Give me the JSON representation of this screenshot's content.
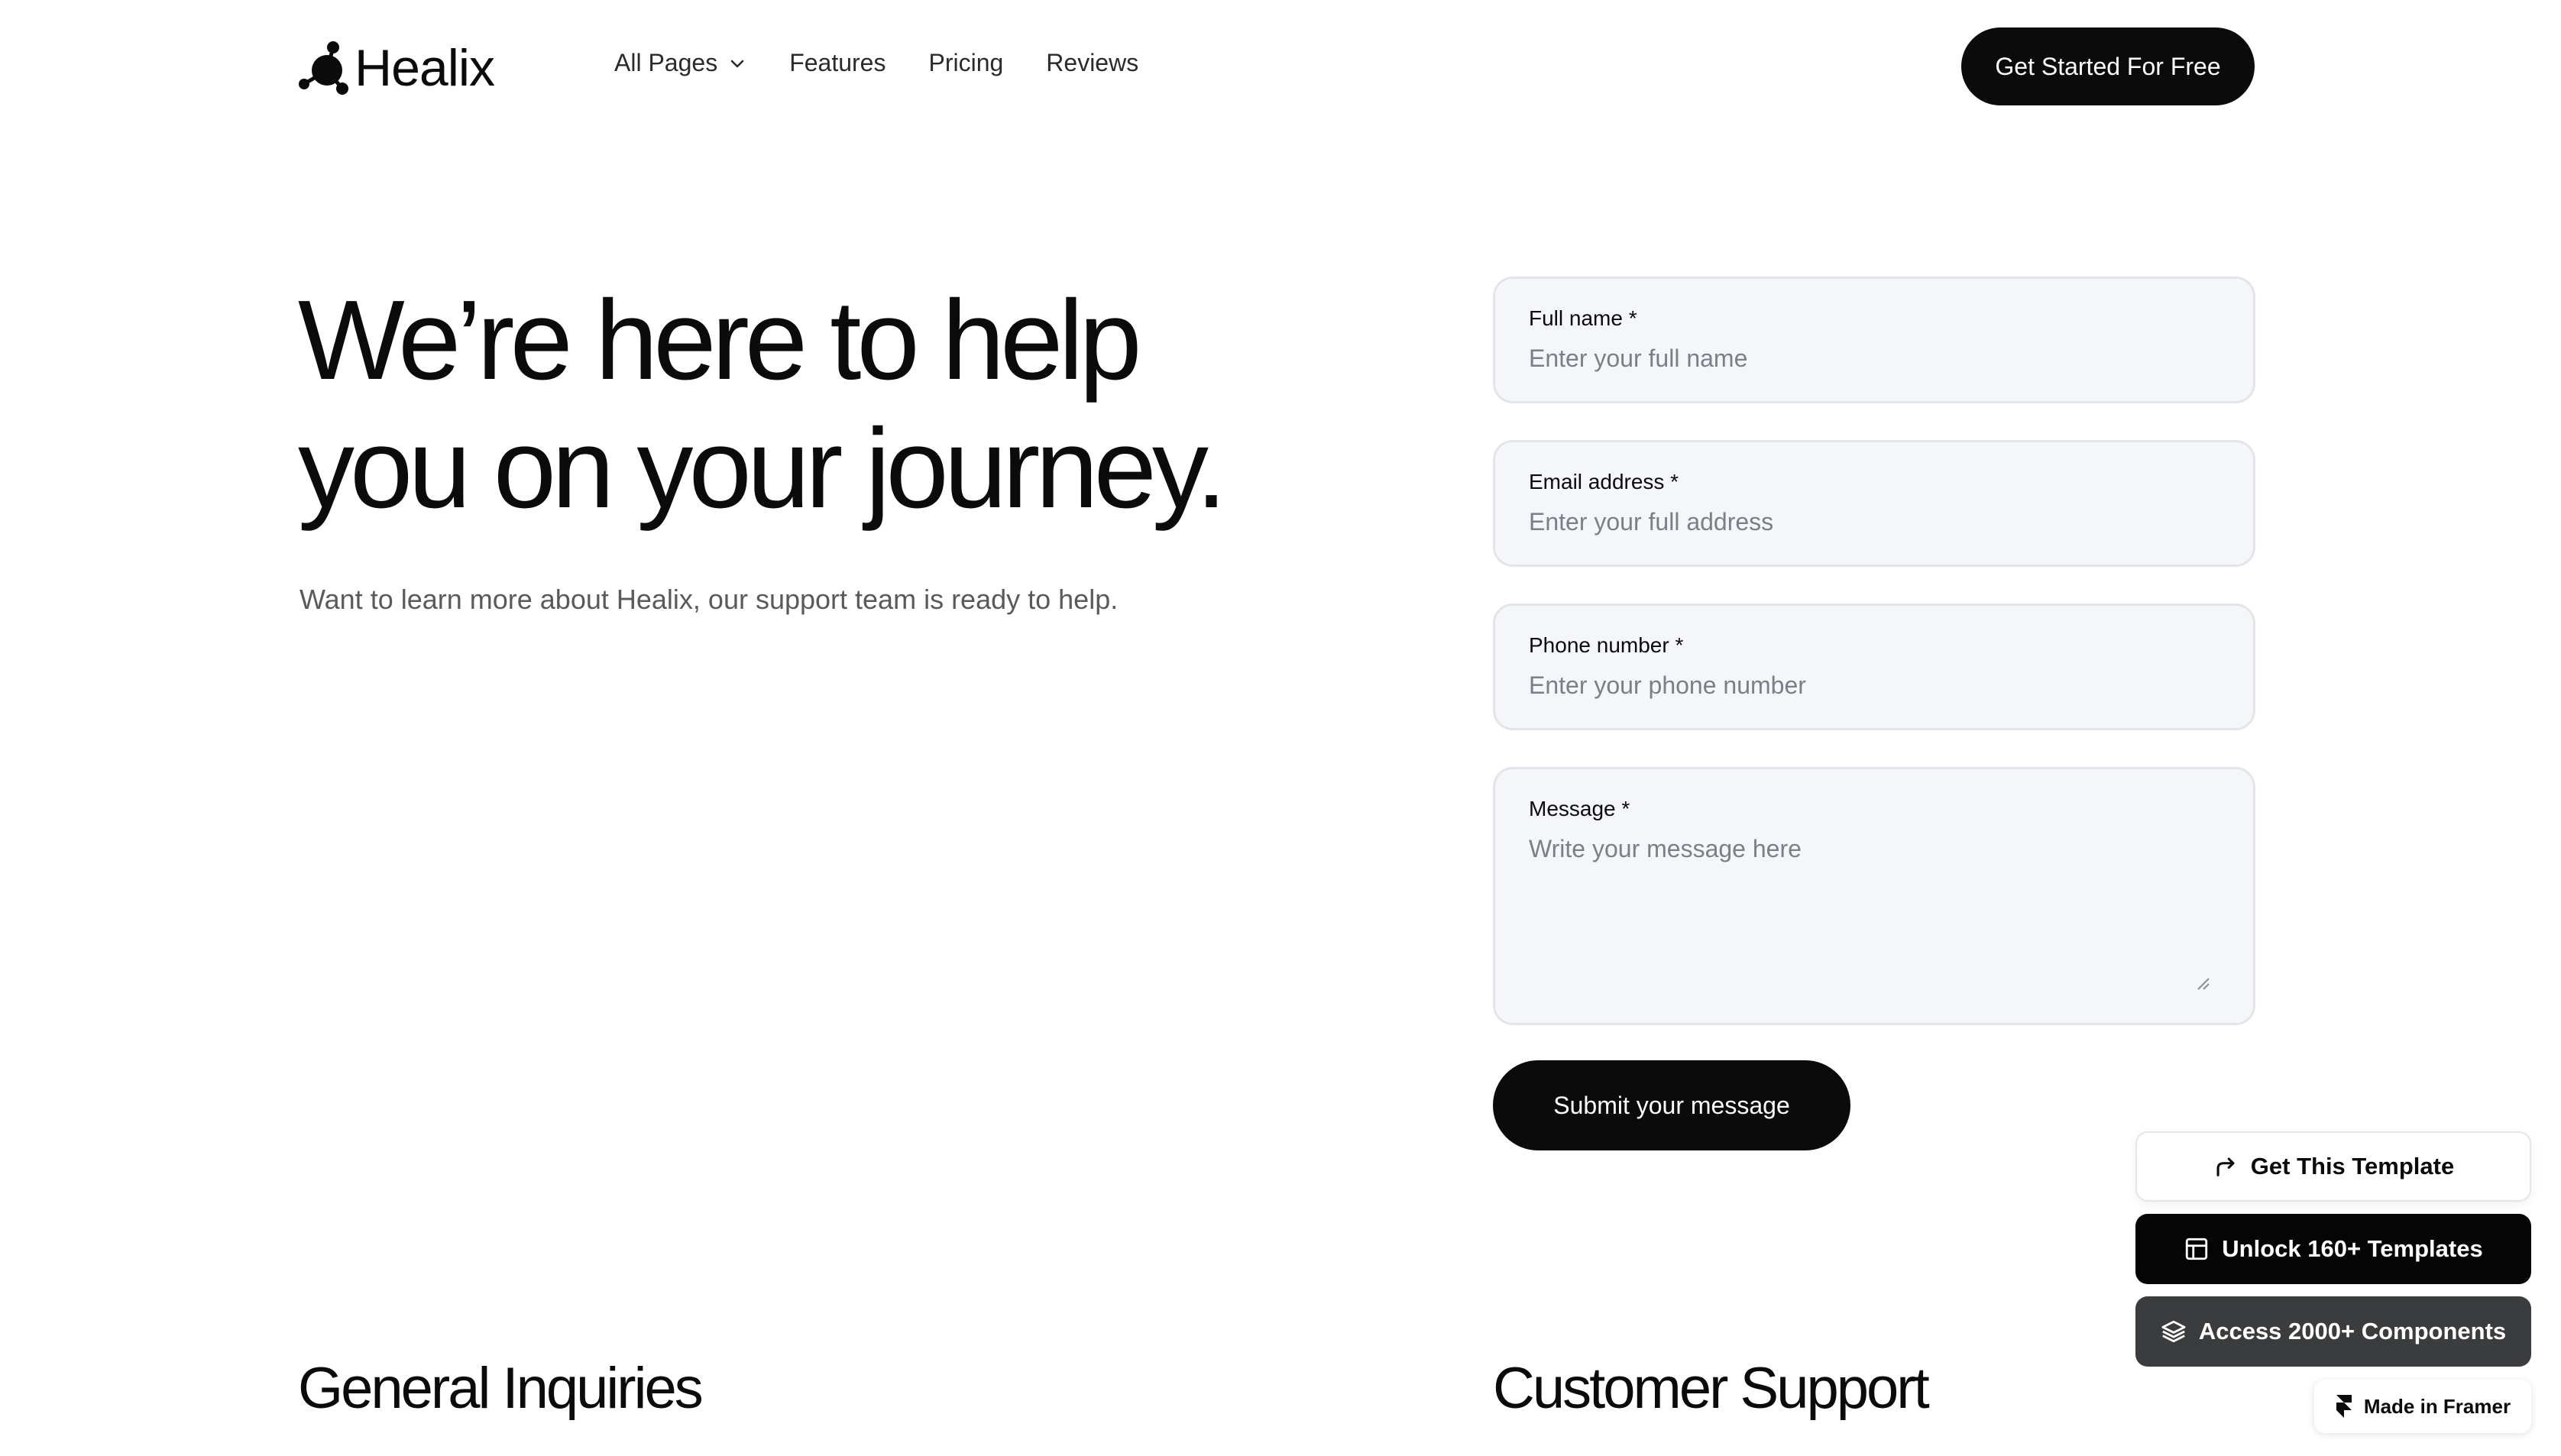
{
  "nav": {
    "brand": "Healix",
    "links": [
      {
        "label": "All Pages",
        "has_dropdown": true
      },
      {
        "label": "Features"
      },
      {
        "label": "Pricing"
      },
      {
        "label": "Reviews"
      }
    ],
    "cta_label": "Get Started For Free"
  },
  "hero": {
    "title_line1": "We’re here to help",
    "title_line2": "you on your journey.",
    "subtitle": "Want to learn more about Healix, our support team is ready to help."
  },
  "form": {
    "full_name": {
      "label": "Full name *",
      "placeholder": "Enter your full name",
      "value": ""
    },
    "email": {
      "label": "Email address *",
      "placeholder": "Enter your full address",
      "value": ""
    },
    "phone": {
      "label": "Phone number *",
      "placeholder": "Enter your phone number",
      "value": ""
    },
    "message": {
      "label": "Message *",
      "placeholder": "Write your message here",
      "value": ""
    },
    "submit_label": "Submit your message"
  },
  "sections": {
    "general_inquiries": "General Inquiries",
    "customer_support": "Customer Support"
  },
  "floating": {
    "get_template": "Get This Template",
    "unlock_templates": "Unlock 160+ Templates",
    "access_components": "Access 2000+ Components",
    "made_in_framer": "Made in Framer"
  },
  "icons": {
    "logo": "molecule-logo-icon",
    "dropdown": "chevron-down-icon",
    "get_template": "share-arrow-icon",
    "unlock_templates": "layout-icon",
    "access_components": "layers-icon",
    "framer": "framer-logo-icon",
    "resize": "resize-grip-icon"
  },
  "colors": {
    "primary": "#0b0b0b",
    "field_background": "#f5f6f9",
    "field_border": "#e3e5ea",
    "muted_text": "#5a5a5a",
    "components_button": "#3b3c3e"
  }
}
